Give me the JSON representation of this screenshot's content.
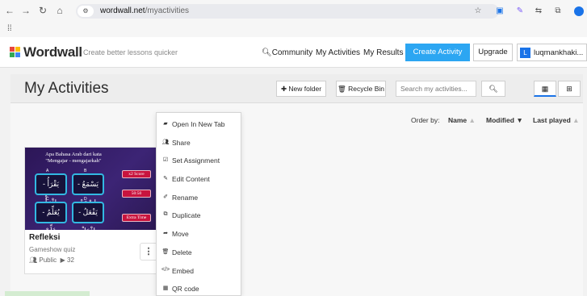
{
  "browser": {
    "url_host": "wordwall.net",
    "url_path": "/myactivities",
    "back_icon": "arrow-left-icon",
    "forward_icon": "arrow-right-icon",
    "reload_icon": "reload-icon",
    "home_icon": "home-icon"
  },
  "header": {
    "logo": "Wordwall",
    "tagline": "Create better lessons quicker",
    "nav": [
      "Community",
      "My Activities",
      "My Results"
    ],
    "create_label": "Create Activity",
    "upgrade_label": "Upgrade",
    "user_initial": "L",
    "user_name": "luqmankhaki...",
    "colors": {
      "create": "#2ca6f2",
      "avatar": "#1a73e8"
    }
  },
  "toolbar": {
    "title": "My Activities",
    "new_folder": "New folder",
    "recycle_bin": "Recycle Bin",
    "search_placeholder": "Search my activities..."
  },
  "sort": {
    "label": "Order by:",
    "options": [
      "Name",
      "Modified",
      "Last played"
    ],
    "active": "Modified"
  },
  "activity": {
    "title": "Refleksi",
    "type": "Gameshow quiz",
    "visibility": "Public",
    "plays": "32",
    "thumbnail": {
      "question_line1": "Apa Bahasa Arab dari kata",
      "question_line2": "\"Mengajar - mengajarkah\"",
      "options": [
        {
          "letter": "A",
          "text": "يَقْرَأُ - اِقْرَأْ"
        },
        {
          "letter": "B",
          "text": "يَسْمَعُ - اِسْمَعْ"
        },
        {
          "letter": "C",
          "text": "يُعَلِّمُ - عَلِّمْ"
        },
        {
          "letter": "D",
          "text": "يَفْعَلُ - اِفْعَلْ"
        }
      ],
      "powerups": [
        "x2 Score",
        "50:50",
        "Extra Time"
      ]
    }
  },
  "context_menu": [
    {
      "label": "Open In New Tab",
      "icon": "folder-open-icon"
    },
    {
      "label": "Share",
      "icon": "share-icon"
    },
    {
      "label": "Set Assignment",
      "icon": "assignment-icon"
    },
    {
      "label": "Edit Content",
      "icon": "pencil-icon"
    },
    {
      "label": "Rename",
      "icon": "rename-icon"
    },
    {
      "label": "Duplicate",
      "icon": "duplicate-icon"
    },
    {
      "label": "Move",
      "icon": "move-icon"
    },
    {
      "label": "Delete",
      "icon": "trash-icon"
    },
    {
      "label": "Embed",
      "icon": "embed-icon"
    },
    {
      "label": "QR code",
      "icon": "qr-code-icon"
    }
  ]
}
